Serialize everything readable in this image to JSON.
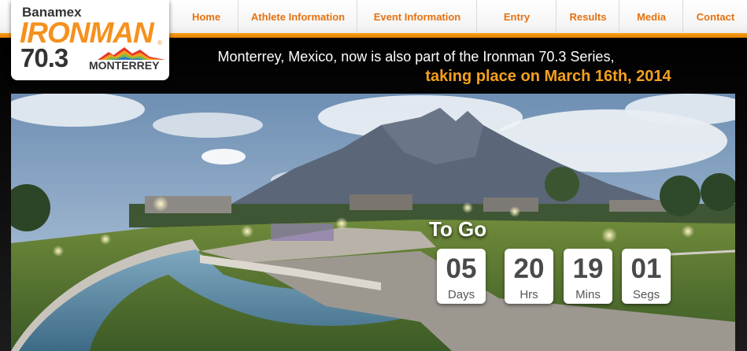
{
  "nav": {
    "items": [
      {
        "label": "Home"
      },
      {
        "label": "Athlete Information"
      },
      {
        "label": "Event Information"
      },
      {
        "label": "Entry"
      },
      {
        "label": "Results"
      },
      {
        "label": "Media"
      },
      {
        "label": "Contact"
      }
    ]
  },
  "logo": {
    "sponsor": "Banamex",
    "brand": "IRONMAN",
    "number": "70.3",
    "city": "MONTERREY"
  },
  "headline": {
    "line1": "Monterrey, Mexico, now is also part of the Ironman 70.3 Series,",
    "line2": "taking place on March 16th, 2014"
  },
  "countdown": {
    "title": "To Go",
    "units": [
      {
        "value": "05",
        "label": "Days"
      },
      {
        "value": "20",
        "label": "Hrs"
      },
      {
        "value": "19",
        "label": "Mins"
      },
      {
        "value": "01",
        "label": "Segs"
      }
    ]
  },
  "colors": {
    "accent_orange": "#f5911e",
    "nav_text": "#e6720f",
    "background": "#000000"
  }
}
